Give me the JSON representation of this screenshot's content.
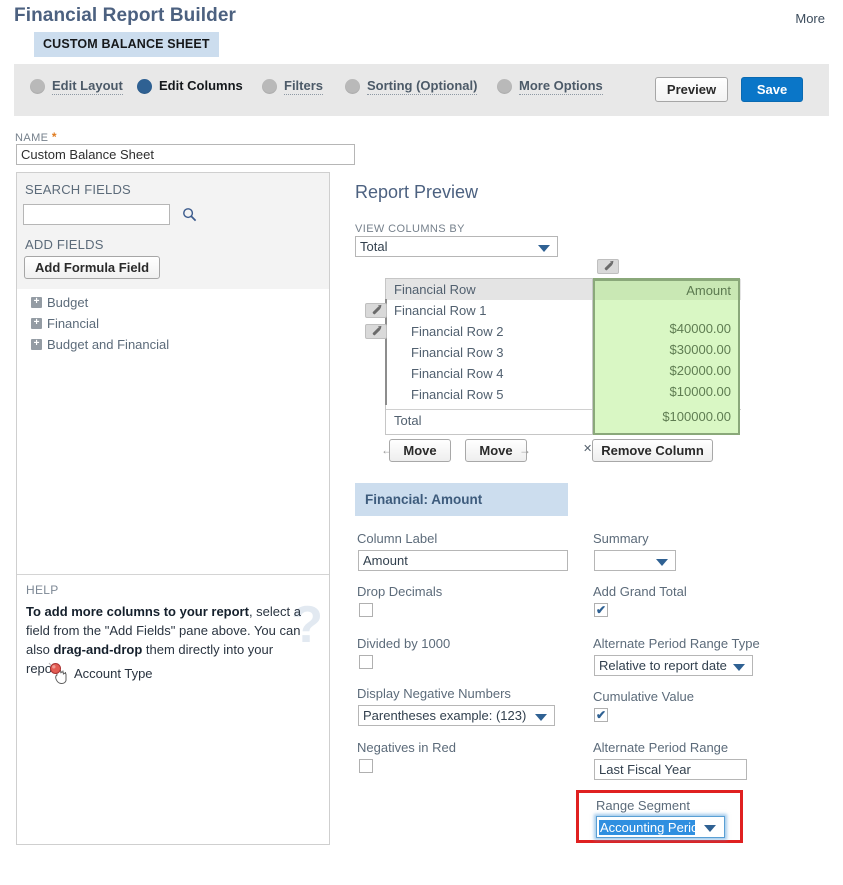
{
  "header": {
    "title": "Financial Report Builder",
    "more_link": "More",
    "record_tab": "CUSTOM BALANCE SHEET"
  },
  "wizard": {
    "steps": [
      {
        "label": "Edit Layout",
        "active": false
      },
      {
        "label": "Edit Columns",
        "active": true
      },
      {
        "label": "Filters",
        "active": false
      },
      {
        "label": "Sorting (Optional)",
        "active": false
      },
      {
        "label": "More Options",
        "active": false
      }
    ],
    "preview_label": "Preview",
    "save_label": "Save"
  },
  "name_field": {
    "label": "NAME",
    "required_marker": "*",
    "value": "Custom Balance Sheet"
  },
  "left_panel": {
    "search_fields_label": "SEARCH FIELDS",
    "search_value": "",
    "search_placeholder": "",
    "search_icon": "search-icon",
    "add_fields_label": "ADD FIELDS",
    "add_formula_label": "Add Formula Field",
    "tree": [
      {
        "label": "Budget",
        "expander": "+"
      },
      {
        "label": "Financial",
        "expander": "+"
      },
      {
        "label": "Budget and Financial",
        "expander": "+"
      }
    ],
    "help": {
      "label": "HELP",
      "line_bold_1": "To add more columns to your report",
      "line_rest_1": ", select a field from the \"Add Fields\" pane above. You can also ",
      "line_bold_2": "drag-and-drop",
      "line_rest_2": " them directly into your report.",
      "watermark": "?",
      "drag_ghost_label": "Account Type",
      "drag_ghost_icon": "no-drop-cursor-icon"
    }
  },
  "report_preview": {
    "title": "Report Preview",
    "view_columns_by_label": "VIEW COLUMNS BY",
    "view_columns_by_value": "Total",
    "table": {
      "row_header": "Financial Row",
      "amount_header": "Amount",
      "rows": [
        {
          "label": "Financial Row 1",
          "amount": "",
          "indent": false
        },
        {
          "label": "Financial Row 2",
          "amount": "$40000.00",
          "indent": true
        },
        {
          "label": "Financial Row 3",
          "amount": "$30000.00",
          "indent": true
        },
        {
          "label": "Financial Row 4",
          "amount": "$20000.00",
          "indent": true
        },
        {
          "label": "Financial Row 5",
          "amount": "$10000.00",
          "indent": true
        }
      ],
      "total_label": "Total",
      "total_amount": "$100000.00"
    },
    "move_left_label": "Move",
    "move_right_label": "Move",
    "remove_column_label": "Remove Column",
    "move_left_arrow": "←",
    "move_right_arrow": "→",
    "remove_x": "✕"
  },
  "column_settings": {
    "section_title": "Financial: Amount",
    "column_label": {
      "label": "Column Label",
      "value": "Amount"
    },
    "drop_decimals": {
      "label": "Drop Decimals",
      "checked": false
    },
    "divided_by_1000": {
      "label": "Divided by 1000",
      "checked": false
    },
    "display_negative_numbers": {
      "label": "Display Negative Numbers",
      "value": "Parentheses  example: (123)"
    },
    "negatives_in_red": {
      "label": "Negatives in Red",
      "checked": false
    },
    "summary": {
      "label": "Summary",
      "value": ""
    },
    "add_grand_total": {
      "label": "Add Grand Total",
      "checked": true
    },
    "alternate_period_range_type": {
      "label": "Alternate Period Range Type",
      "value": "Relative to report date"
    },
    "cumulative_value": {
      "label": "Cumulative Value",
      "checked": true
    },
    "alternate_period_range": {
      "label": "Alternate Period Range",
      "value": "Last Fiscal Year"
    },
    "range_segment": {
      "label": "Range Segment",
      "value": "Accounting Period",
      "highlighted": true,
      "selected": true
    }
  },
  "colors": {
    "accent_blue": "#2f6193",
    "save_blue": "#0a76c8",
    "tab_blue": "#ccddee",
    "selected_column_green": "#d9f7c4",
    "selected_column_green_header": "#c9e8b4",
    "highlight_red": "#e02020",
    "selection_blue": "#2f8fe0",
    "required_orange": "#e07b1f",
    "wizard_bar_gray": "#e8e8e8"
  }
}
